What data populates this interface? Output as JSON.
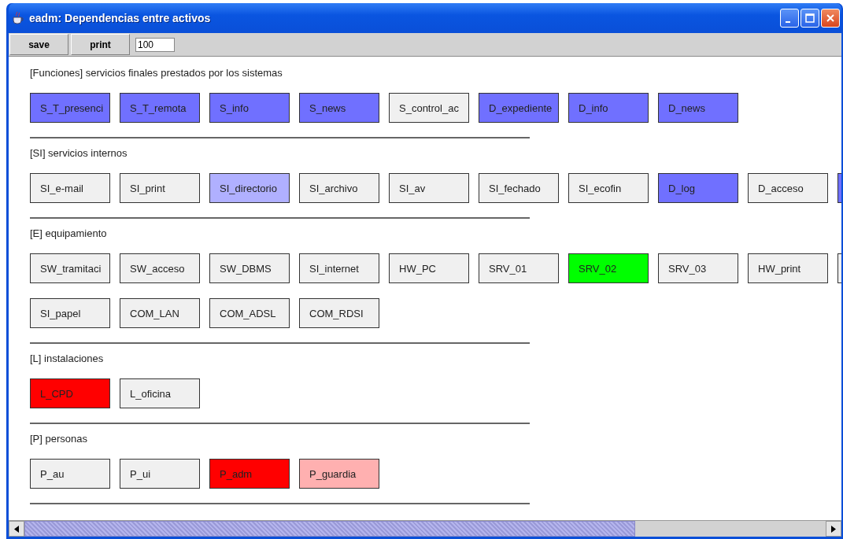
{
  "window": {
    "title": "eadm: Dependencias entre activos"
  },
  "toolbar": {
    "buttons": [
      "save",
      "print"
    ],
    "zoom_field": {
      "value": "100"
    }
  },
  "sections": [
    {
      "title": "[Funciones] servicios finales prestados por los sistemas",
      "assets": [
        {
          "label": "S_T_presenci",
          "color": "#7070ff"
        },
        {
          "label": "S_T_remota",
          "color": "#7070ff"
        },
        {
          "label": "S_info",
          "color": "#7070ff"
        },
        {
          "label": "S_news",
          "color": "#7070ff"
        },
        {
          "label": "S_control_ac",
          "color": "#f0f0f0"
        },
        {
          "label": "D_expediente",
          "color": "#7070ff"
        },
        {
          "label": "D_info",
          "color": "#7070ff"
        },
        {
          "label": "D_news",
          "color": "#7070ff"
        }
      ]
    },
    {
      "title": "[SI] servicios internos",
      "assets": [
        {
          "label": "SI_e-mail",
          "color": "#f0f0f0"
        },
        {
          "label": "SI_print",
          "color": "#f0f0f0"
        },
        {
          "label": "SI_directorio",
          "color": "#b0b0ff"
        },
        {
          "label": "SI_archivo",
          "color": "#f0f0f0"
        },
        {
          "label": "SI_av",
          "color": "#f0f0f0"
        },
        {
          "label": "SI_fechado",
          "color": "#f0f0f0"
        },
        {
          "label": "SI_ecofin",
          "color": "#f0f0f0"
        },
        {
          "label": "D_log",
          "color": "#7070ff"
        },
        {
          "label": "D_acceso",
          "color": "#f0f0f0"
        },
        {
          "color": "#7070ff"
        }
      ]
    },
    {
      "title": "[E] equipamiento",
      "assets": [
        {
          "label": "SW_tramitaci",
          "color": "#f0f0f0"
        },
        {
          "label": "SW_acceso",
          "color": "#f0f0f0"
        },
        {
          "label": "SW_DBMS",
          "color": "#f0f0f0"
        },
        {
          "label": "SI_internet",
          "color": "#f0f0f0"
        },
        {
          "label": "HW_PC",
          "color": "#f0f0f0"
        },
        {
          "label": "SRV_01",
          "color": "#f0f0f0"
        },
        {
          "label": "SRV_02",
          "color": "#00ff00"
        },
        {
          "label": "SRV_03",
          "color": "#f0f0f0"
        },
        {
          "label": "HW_print",
          "color": "#f0f0f0"
        },
        {
          "color": "#f0f0f0"
        },
        {
          "label": "SI_papel",
          "color": "#f0f0f0"
        },
        {
          "label": "COM_LAN",
          "color": "#f0f0f0"
        },
        {
          "label": "COM_ADSL",
          "color": "#f0f0f0"
        },
        {
          "label": "COM_RDSI",
          "color": "#f0f0f0"
        }
      ]
    },
    {
      "title": "[L] instalaciones",
      "assets": [
        {
          "label": "L_CPD",
          "color": "#ff0000"
        },
        {
          "label": "L_oficina",
          "color": "#f0f0f0"
        }
      ]
    },
    {
      "title": "[P] personas",
      "assets": [
        {
          "label": "P_au",
          "color": "#f0f0f0"
        },
        {
          "label": "P_ui",
          "color": "#f0f0f0"
        },
        {
          "label": "P_adm",
          "color": "#ff0000"
        },
        {
          "label": "P_guardia",
          "color": "#ffb0b0"
        }
      ]
    }
  ]
}
